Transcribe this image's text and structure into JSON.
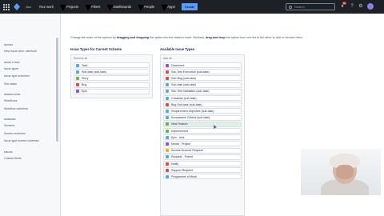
{
  "topnav": {
    "brand": "Jira",
    "items": [
      "Your work",
      "Projects",
      "Filters",
      "Dashboards",
      "People",
      "Apps"
    ],
    "create": "Create",
    "search_placeholder": "Search",
    "notification_count": "9+"
  },
  "sidebar": {
    "items": [
      {
        "label": "Issues",
        "kind": "head"
      },
      {
        "label": "New issue view: rate/form",
        "kind": "item"
      },
      {
        "label": "Issue types",
        "kind": "head"
      },
      {
        "label": "Issue types",
        "kind": "item"
      },
      {
        "label": "Issue type schemes",
        "kind": "item"
      },
      {
        "label": "Sub-tasks",
        "kind": "item"
      },
      {
        "label": "Workflows",
        "kind": "head"
      },
      {
        "label": "Workflows",
        "kind": "item"
      },
      {
        "label": "Workflow schemes",
        "kind": "item"
      },
      {
        "label": "Screens",
        "kind": "head"
      },
      {
        "label": "Screens",
        "kind": "item"
      },
      {
        "label": "Screen schemes",
        "kind": "item"
      },
      {
        "label": "Issue type screen schemes",
        "kind": "item"
      },
      {
        "label": "Fields",
        "kind": "head"
      },
      {
        "label": "Custom fields",
        "kind": "item"
      }
    ]
  },
  "main": {
    "description_pre": "Change the order of the options by ",
    "description_b1": "dragging and dropping",
    "description_mid": " the option into the desired order. Similarly, ",
    "description_b2": "drag and drop",
    "description_post": " the option from one list to the other to add or remove them.",
    "current_title": "Issue Types for Current Scheme",
    "current_label": "Remove all",
    "current": [
      {
        "label": "Task",
        "color": "#4bade8"
      },
      {
        "label": "Sub-task (sub-task)",
        "color": "#4bade8"
      },
      {
        "label": "Story",
        "color": "#63ba3c"
      },
      {
        "label": "Bug",
        "color": "#e5493a"
      },
      {
        "label": "Epic",
        "color": "#904ee2"
      }
    ],
    "available_title": "Available Issue Types",
    "available_label": "Add all",
    "available": [
      {
        "label": "Document",
        "color": "#904ee2"
      },
      {
        "label": "Sub Test Execution (sub-task)",
        "color": "#e5493a"
      },
      {
        "label": "Sub-Bug (sub-task)",
        "color": "#e5493a"
      },
      {
        "label": "Sub-task (sub-task)",
        "color": "#4bade8"
      },
      {
        "label": "Sub Test Validation (sub-task)",
        "color": "#4bade8"
      },
      {
        "label": "Checklist (sub-task)",
        "color": "#4bade8"
      },
      {
        "label": "Bug Sub-task (sub-task)",
        "color": "#e5493a"
      },
      {
        "label": "Requirement Objective (sub-task)",
        "color": "#4bade8"
      },
      {
        "label": "Acceptance Criteria (sub-task)",
        "color": "#4bade8"
      },
      {
        "label": "New Feature",
        "color": "#63ba3c"
      },
      {
        "label": "Improvement",
        "color": "#63ba3c"
      },
      {
        "label": "Epic - Arts",
        "color": "#4bade8"
      },
      {
        "label": "Media - Project",
        "color": "#904ee2"
      },
      {
        "label": "Access Account Request",
        "color": "#ffab00"
      },
      {
        "label": "Request - Potent",
        "color": "#4bade8"
      },
      {
        "label": "Notify",
        "color": "#e5493a"
      },
      {
        "label": "Support Request",
        "color": "#e5493a"
      },
      {
        "label": "Programme of Work",
        "color": "#4bade8"
      }
    ],
    "available_selected_index": 9
  },
  "colors": {
    "nav_bg": "#1d2125",
    "accent": "#579dff",
    "selected_row": "#dff0e6"
  }
}
